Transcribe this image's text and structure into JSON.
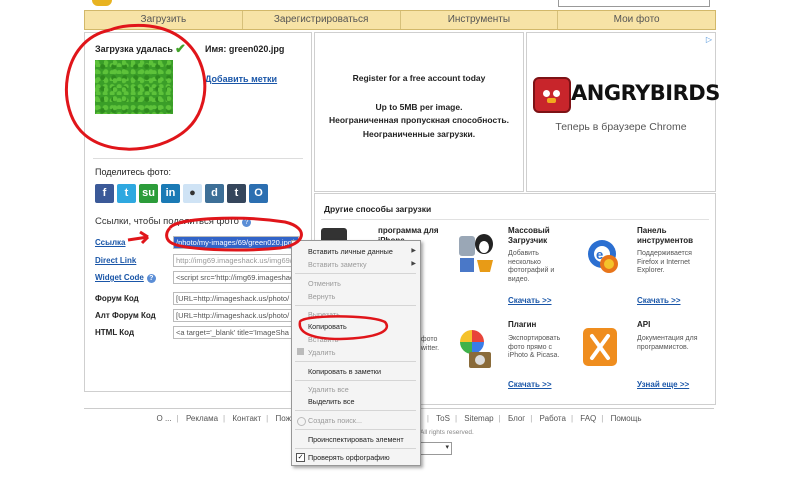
{
  "nav": [
    "Загрузить",
    "Зарегистрироваться",
    "Инструменты",
    "Мои фото"
  ],
  "upload": {
    "status": "Загрузка удалась",
    "filename_label": "Имя: green020.jpg",
    "add_tags": "Добавить метки"
  },
  "share": {
    "title": "Поделитесь фото:",
    "icons": [
      "facebook-icon",
      "twitter-icon",
      "stumbleupon-icon",
      "linkedin-icon",
      "reddit-icon",
      "digg-icon",
      "tumblr-icon",
      "other-share-icon"
    ],
    "colors": [
      "#3b5998",
      "#2fa8e0",
      "#2c9c3a",
      "#1a7ab5",
      "#cfe3f5",
      "#3d6f97",
      "#35465c",
      "#2c6fb1"
    ]
  },
  "links": {
    "title": "Ссылки, чтобы поделиться фото",
    "rows": [
      {
        "label": "Ссылка",
        "value": "/photo/my-images/69/green020.jpg/"
      },
      {
        "label": "Direct Link",
        "value": "http://img69.imageshack.us/img69/"
      },
      {
        "label": "Widget Code",
        "value": "<script src='http://img69.imageshack"
      },
      {
        "label": "Форум Код",
        "value": "[URL=http://imageshack.us/photo/"
      },
      {
        "label": "Алт Форум Код",
        "value": "[URL=http://imageshack.us/photo/"
      },
      {
        "label": "HTML Код",
        "value": "<a target='_blank' title='ImageSha"
      }
    ]
  },
  "register": {
    "line1": "Register for a free account today",
    "line2": "Up to 5MB per image.",
    "line3": "Неограниченная пропускная способность.",
    "line4": "Неограниченные загрузки."
  },
  "ad": {
    "corner": "▷",
    "title": "ANGRYBIRDS",
    "subtitle": "Теперь в браузере Chrome"
  },
  "other": {
    "title": "Другие способы загрузки",
    "cards": [
      {
        "title": "программа для iPhone",
        "desc": "...",
        "more": ""
      },
      {
        "title": "Массовый Загрузчик",
        "desc": "Добавить несколько фотографий и видео.",
        "more": "Скачать >>"
      },
      {
        "title": "Панель инструментов",
        "desc": "Поддерживается Firefox и Internet Explorer.",
        "more": "Скачать >>"
      },
      {
        "title": "",
        "desc": "...фото ...witter.",
        "more": ""
      },
      {
        "title": "Плагин",
        "desc": "Экспортировать фото прямо с iPhoto & Picasa.",
        "more": "Скачать >>"
      },
      {
        "title": "API",
        "desc": "Документация для программистов.",
        "more": "Узнай еще >>"
      }
    ]
  },
  "context_menu": {
    "items": [
      {
        "label": "Вставить личные данные",
        "disabled": false,
        "submenu": true
      },
      {
        "label": "Вставить заметку",
        "disabled": true,
        "submenu": true
      },
      {
        "label": "Отменить",
        "disabled": true
      },
      {
        "label": "Вернуть",
        "disabled": true
      },
      {
        "label": "Вырезать",
        "disabled": true
      },
      {
        "label": "Копировать",
        "disabled": false
      },
      {
        "label": "Вставить",
        "disabled": true
      },
      {
        "label": "Удалить",
        "disabled": true
      },
      {
        "label": "Копировать в заметки",
        "disabled": false
      },
      {
        "label": "Удалить все",
        "disabled": true
      },
      {
        "label": "Выделить все",
        "disabled": false
      },
      {
        "label": "Создать поиск...",
        "disabled": true
      },
      {
        "label": "Проинспектировать элемент",
        "disabled": false
      },
      {
        "label": "Проверять орфографию",
        "disabled": false,
        "checked": true
      }
    ]
  },
  "footer": {
    "links": [
      "О ...",
      "Реклама",
      "Контакт",
      "Пож...",
      "ToS",
      "Sitemap",
      "Блог",
      "Работа",
      "FAQ",
      "Помощь"
    ],
    "copyright": "All rights reserved."
  }
}
